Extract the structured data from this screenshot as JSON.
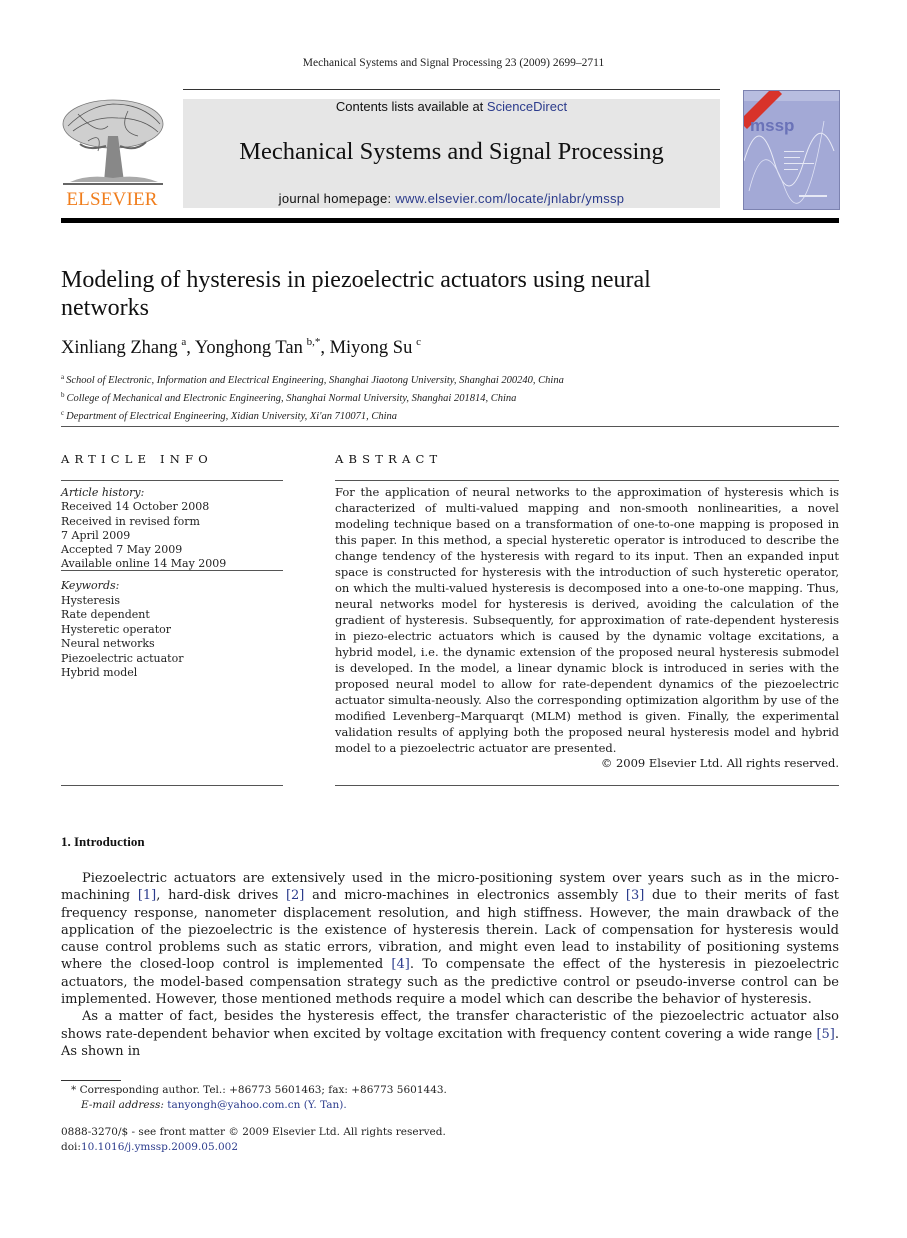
{
  "running_head": "Mechanical Systems and Signal Processing 23 (2009) 2699–2711",
  "masthead": {
    "contents_prefix": "Contents lists available at ",
    "contents_link": "ScienceDirect",
    "journal_name": "Mechanical Systems and Signal Processing",
    "homepage_prefix": "journal homepage: ",
    "homepage_url": "www.elsevier.com/locate/jnlabr/ymssp",
    "publisher": "ELSEVIER",
    "cover_label": "mssp",
    "brand_color": "#f07d1c",
    "link_color": "#2b3b8c"
  },
  "article": {
    "title": "Modeling of hysteresis in piezoelectric actuators using neural networks",
    "authors": [
      {
        "name": "Xinliang Zhang",
        "mark": "a"
      },
      {
        "name": "Yonghong Tan",
        "mark": "b,*"
      },
      {
        "name": "Miyong Su",
        "mark": "c"
      }
    ],
    "affiliations": [
      {
        "mark": "a",
        "text": "School of Electronic, Information and Electrical Engineering, Shanghai Jiaotong University, Shanghai 200240, China"
      },
      {
        "mark": "b",
        "text": "College of Mechanical and Electronic Engineering, Shanghai Normal University, Shanghai 201814, China"
      },
      {
        "mark": "c",
        "text": "Department of Electrical Engineering, Xidian University, Xi'an 710071, China"
      }
    ]
  },
  "article_info": {
    "heading": "ARTICLE INFO",
    "history_label": "Article history:",
    "history": [
      "Received 14 October 2008",
      "Received in revised form",
      "7 April 2009",
      "Accepted 7 May 2009",
      "Available online 14 May 2009"
    ],
    "keywords_label": "Keywords:",
    "keywords": [
      "Hysteresis",
      "Rate dependent",
      "Hysteretic operator",
      "Neural networks",
      "Piezoelectric actuator",
      "Hybrid model"
    ]
  },
  "abstract": {
    "heading": "ABSTRACT",
    "text": "For the application of neural networks to the approximation of hysteresis which is characterized of multi-valued mapping and non-smooth nonlinearities, a novel modeling technique based on a transformation of one-to-one mapping is proposed in this paper. In this method, a special hysteretic operator is introduced to describe the change tendency of the hysteresis with regard to its input. Then an expanded input space is constructed for hysteresis with the introduction of such hysteretic operator, on which the multi-valued hysteresis is decomposed into a one-to-one mapping. Thus, neural networks model for hysteresis is derived, avoiding the calculation of the gradient of hysteresis. Subsequently, for approximation of rate-dependent hysteresis in piezo-electric actuators which is caused by the dynamic voltage excitations, a hybrid model, i.e. the dynamic extension of the proposed neural hysteresis submodel is developed. In the model, a linear dynamic block is introduced in series with the proposed neural model to allow for rate-dependent dynamics of the piezoelectric actuator simulta-neously. Also the corresponding optimization algorithm by use of the modified Levenberg–Marquarqt (MLM) method is given. Finally, the experimental validation results of applying both the proposed neural hysteresis model and hybrid model to a piezoelectric actuator are presented.",
    "copyright": "© 2009 Elsevier Ltd. All rights reserved."
  },
  "introduction": {
    "heading": "1.  Introduction",
    "p1": [
      {
        "t": "Piezoelectric actuators are extensively used in the micro-positioning system over years such as in the micro-machining "
      },
      {
        "ref": "[1]"
      },
      {
        "t": ", hard-disk drives "
      },
      {
        "ref": "[2]"
      },
      {
        "t": " and micro-machines in electronics assembly "
      },
      {
        "ref": "[3]"
      },
      {
        "t": " due to their merits of fast frequency response, nanometer displacement resolution, and high stiffness. However, the main drawback of the application of the piezoelectric is the existence of hysteresis therein. Lack of compensation for hysteresis would cause control problems such as static errors, vibration, and might even lead to instability of positioning systems where the closed-loop control is implemented "
      },
      {
        "ref": "[4]"
      },
      {
        "t": ". To compensate the effect of the hysteresis in piezoelectric actuators, the model-based compensation strategy such as the predictive control or pseudo-inverse control can be implemented. However, those mentioned methods require a model which can describe the behavior of hysteresis."
      }
    ],
    "p2": [
      {
        "t": "As a matter of fact, besides the hysteresis effect, the transfer characteristic of the piezoelectric actuator also shows rate-dependent behavior when excited by voltage excitation with frequency content covering a wide range "
      },
      {
        "ref": "[5]"
      },
      {
        "t": ". As shown in"
      }
    ]
  },
  "footnote": {
    "corresponding": "* Corresponding author. Tel.: +86773 5601463; fax: +86773 5601443.",
    "email_label": "E-mail address: ",
    "email": "tanyongh@yahoo.com.cn (Y. Tan).",
    "issn": "0888-3270/$ - see front matter © 2009 Elsevier Ltd. All rights reserved.",
    "doi_prefix": "doi:",
    "doi": "10.1016/j.ymssp.2009.05.002"
  }
}
